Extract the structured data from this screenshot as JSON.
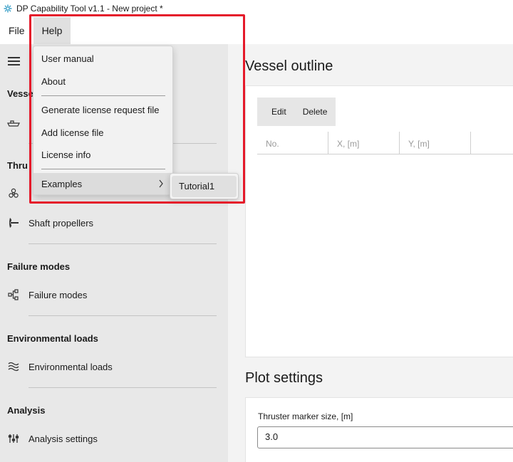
{
  "window": {
    "title": "DP Capability Tool v1.1 - New project *"
  },
  "menubar": {
    "file": "File",
    "help": "Help"
  },
  "help_menu": {
    "items": [
      "User manual",
      "About",
      "Generate license request file",
      "Add license file",
      "License info",
      "Examples"
    ],
    "submenu": [
      "Tutorial1"
    ]
  },
  "sidebar": {
    "vessel_section": "Vesse",
    "thrusters_section": "Thru",
    "shaft_propellers": "Shaft propellers",
    "failure_modes_section": "Failure modes",
    "failure_modes": "Failure modes",
    "env_loads_section": "Environmental loads",
    "env_loads": "Environmental loads",
    "analysis_section": "Analysis",
    "analysis_settings": "Analysis settings"
  },
  "main": {
    "vessel_outline_title": "Vessel outline",
    "edit_label": "Edit",
    "delete_label": "Delete",
    "columns": [
      "No.",
      "X, [m]",
      "Y, [m]"
    ],
    "plot_settings_title": "Plot settings",
    "marker_size_label": "Thruster marker size, [m]",
    "marker_size_value": "3.0"
  },
  "colors": {
    "highlight": "#e5192a",
    "accent_icon": "#3aa0c8"
  }
}
